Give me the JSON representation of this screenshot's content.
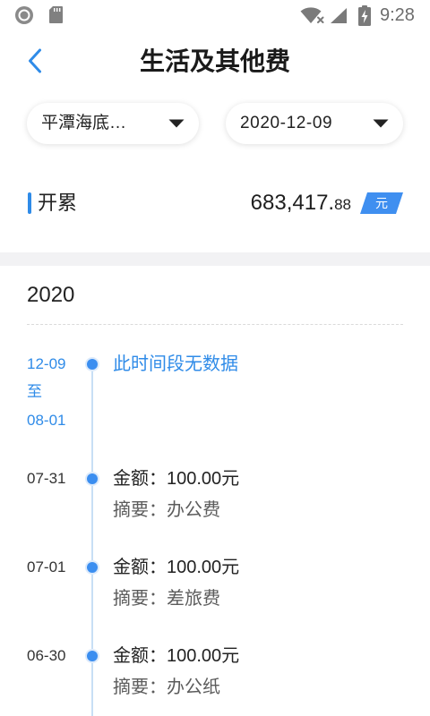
{
  "status_bar": {
    "time": "9:28",
    "icons": {
      "left": [
        "record-icon",
        "sd-card-icon"
      ],
      "right": [
        "wifi-no-internet-icon",
        "signal-icon",
        "battery-charging-icon"
      ]
    }
  },
  "header": {
    "title": "生活及其他费",
    "back_icon": "chevron-left-icon"
  },
  "filters": {
    "project": {
      "value": "平潭海底…",
      "icon": "caret-down-icon"
    },
    "date": {
      "value": "2020-12-09",
      "icon": "caret-down-icon"
    }
  },
  "summary": {
    "label": "开累",
    "amount_main": "683,417.",
    "amount_decimal": "88",
    "unit": "元"
  },
  "timeline": {
    "year": "2020",
    "entries": [
      {
        "date_lines": [
          "12-09",
          "至",
          "08-01"
        ],
        "message": "此时间段无数据"
      },
      {
        "date": "07-31",
        "amount_label": "金额：",
        "amount": "100.00元",
        "summary_label": "摘要：",
        "summary": "办公费"
      },
      {
        "date": "07-01",
        "amount_label": "金额：",
        "amount": "100.00元",
        "summary_label": "摘要：",
        "summary": "差旅费"
      },
      {
        "date": "06-30",
        "amount_label": "金额：",
        "amount": "100.00元",
        "summary_label": "摘要：",
        "summary": "办公纸"
      }
    ]
  },
  "colors": {
    "accent": "#2f8be8",
    "dot": "#3b8ef0",
    "timeline_line": "#c8dff5",
    "section_band": "#f2f2f4",
    "badge": "#3f8ff0",
    "text_primary": "#222222",
    "text_secondary": "#5c5c5c"
  }
}
